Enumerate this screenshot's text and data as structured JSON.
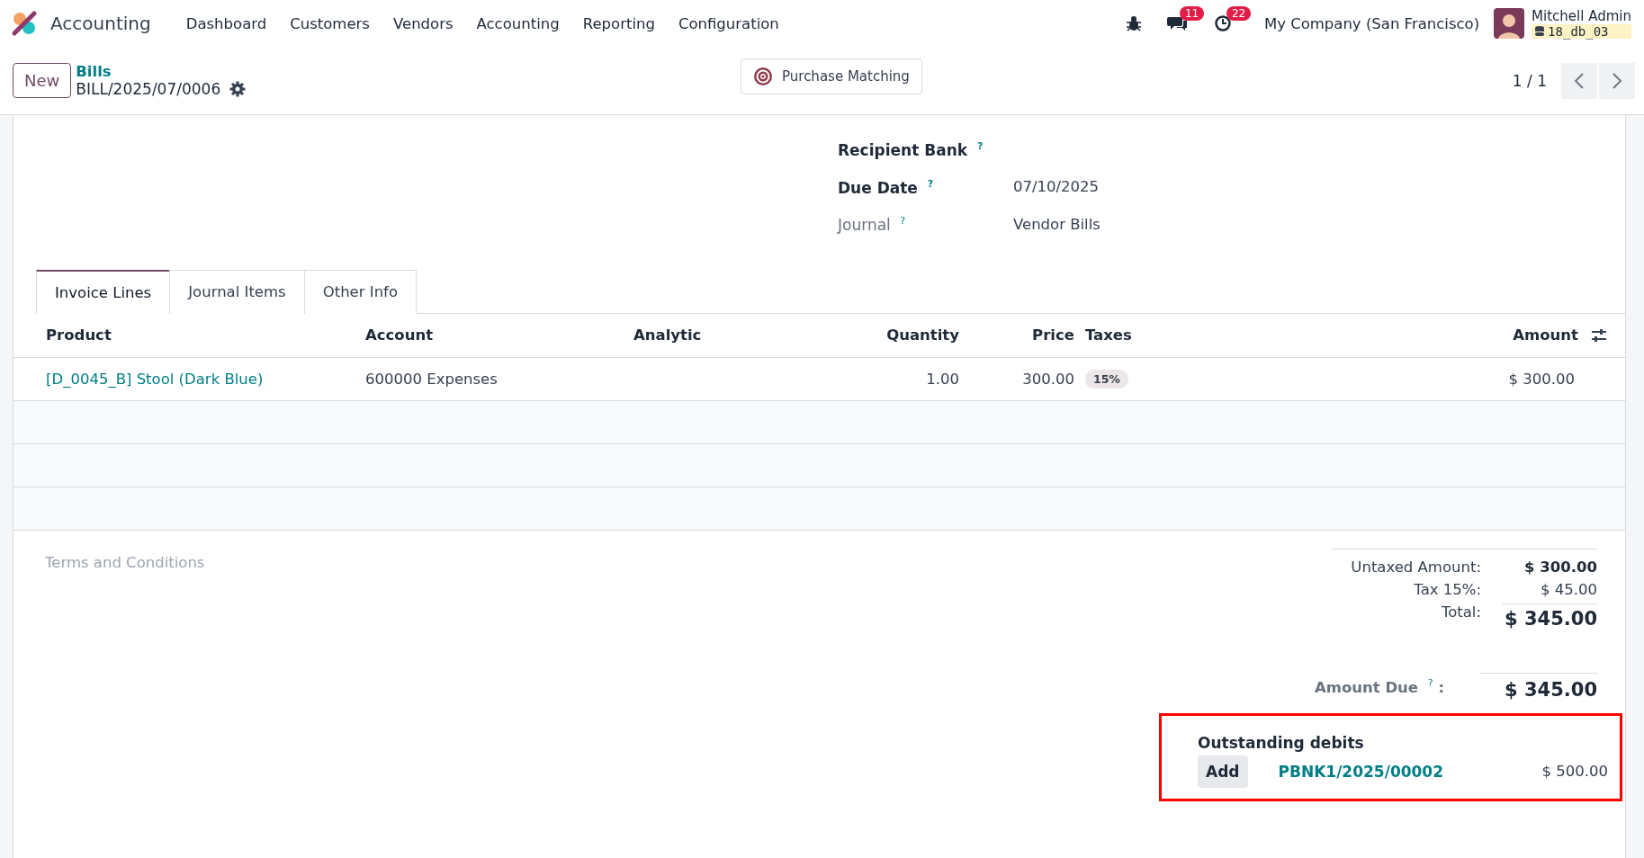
{
  "navbar": {
    "app_name": "Accounting",
    "menu": [
      "Dashboard",
      "Customers",
      "Vendors",
      "Accounting",
      "Reporting",
      "Configuration"
    ],
    "messages_count": "11",
    "activities_count": "22",
    "company": "My Company (San Francisco)",
    "user": "Mitchell Admin",
    "database": "18_db_03"
  },
  "control_panel": {
    "new_button": "New",
    "breadcrumb": "Bills",
    "record": "BILL/2025/07/0006",
    "action_button": "Purchase Matching",
    "pager": "1 / 1"
  },
  "fields": [
    {
      "label": "Recipient Bank",
      "help": "?",
      "bold": true
    },
    {
      "label": "Due Date",
      "help": "?",
      "bold": true,
      "value": "07/10/2025"
    },
    {
      "label": "Journal",
      "help": "?",
      "bold": false,
      "value": "Vendor Bills"
    }
  ],
  "tabs": [
    {
      "label": "Invoice Lines",
      "selected": true
    },
    {
      "label": "Journal Items",
      "selected": false
    },
    {
      "label": "Other Info",
      "selected": false
    }
  ],
  "table": {
    "columns": [
      {
        "label": "Product"
      },
      {
        "label": "Account"
      },
      {
        "label": "Analytic"
      },
      {
        "label": "Quantity"
      },
      {
        "label": "Price"
      },
      {
        "label": "Taxes"
      },
      {
        "label": "Amount"
      }
    ],
    "rows": [
      {
        "product": "[D_0045_B] Stool (Dark Blue)",
        "account": "600000 Expenses",
        "quantity": "1.00",
        "price": "300.00",
        "taxes": [
          "15%"
        ],
        "amount": "$ 300.00"
      }
    ]
  },
  "terms_placeholder": "Terms and Conditions",
  "totals": [
    {
      "label": "Untaxed Amount:",
      "value": "$ 300.00",
      "kind": "subtotal"
    },
    {
      "label": "Tax 15%:",
      "value": "$ 45.00",
      "kind": "tax"
    },
    {
      "label": "Total:",
      "value": "$ 345.00",
      "kind": "total"
    }
  ],
  "amount_due": {
    "label": "Amount Due",
    "help": "?",
    "colon": ":",
    "value": "$ 345.00"
  },
  "outstanding": {
    "title": "Outstanding debits",
    "highlighted": true,
    "lines": [
      {
        "button": "Add",
        "reference": "PBNK1/2025/00002",
        "amount": "$ 500.00"
      }
    ]
  }
}
